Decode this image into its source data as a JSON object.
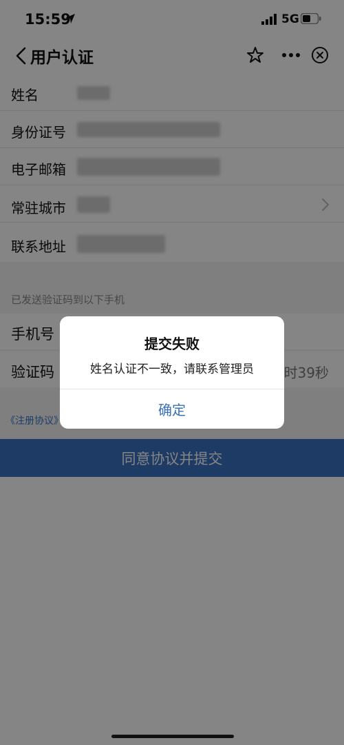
{
  "status_bar": {
    "time": "15:59",
    "network": "5G"
  },
  "nav": {
    "title": "用户认证"
  },
  "form": {
    "rows": [
      {
        "label": "姓名"
      },
      {
        "label": "身份证号"
      },
      {
        "label": "电子邮箱"
      },
      {
        "label": "常驻城市"
      },
      {
        "label": "联系地址"
      }
    ],
    "sent_note": "已发送验证码到以下手机",
    "phone_label": "手机号",
    "code_label": "验证码",
    "countdown": "时39秒",
    "agreement_link": "《注册协议》"
  },
  "submit": {
    "label": "同意协议并提交"
  },
  "dialog": {
    "title": "提交失败",
    "message": "姓名认证不一致，请联系管理员",
    "confirm_label": "确定"
  },
  "colors": {
    "accent": "#3a72c2",
    "link": "#3a6fb5"
  },
  "icons": [
    "location-arrow-icon",
    "signal-icon",
    "battery-icon",
    "back-icon",
    "star-icon",
    "more-icon",
    "close-icon",
    "chevron-right-icon"
  ]
}
